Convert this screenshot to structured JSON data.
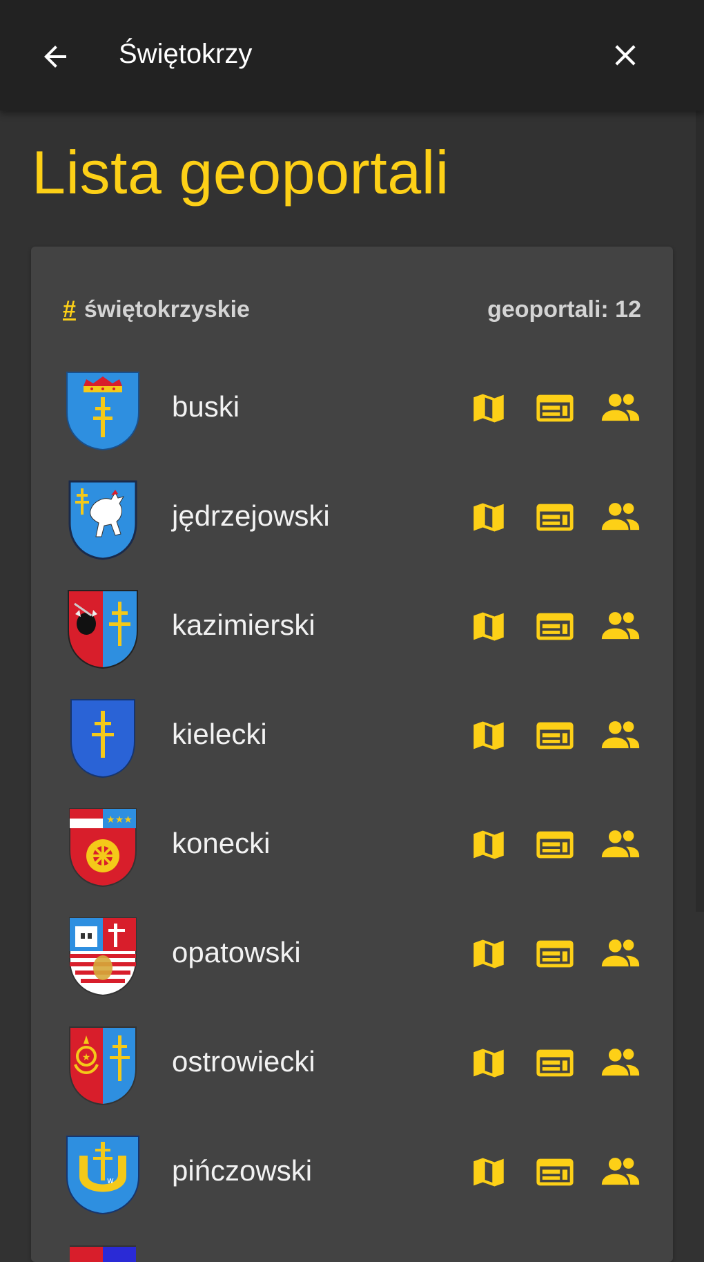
{
  "search": {
    "query": "Świętokrzy"
  },
  "icons": {
    "back": "arrow-left-icon",
    "close": "close-icon",
    "map": "map-icon",
    "web": "web-asset-icon",
    "users": "people-icon"
  },
  "colors": {
    "accent": "#fdd017",
    "background": "#323232",
    "card": "#434343",
    "topbar": "#222222"
  },
  "page_title": "Lista geoportali",
  "region": {
    "hash": "#",
    "name": "świętokrzyskie",
    "count_label": "geoportali: 12"
  },
  "items": [
    {
      "name": "buski"
    },
    {
      "name": "jędrzejowski"
    },
    {
      "name": "kazimierski"
    },
    {
      "name": "kielecki"
    },
    {
      "name": "konecki"
    },
    {
      "name": "opatowski"
    },
    {
      "name": "ostrowiecki"
    },
    {
      "name": "pińczowski"
    }
  ]
}
